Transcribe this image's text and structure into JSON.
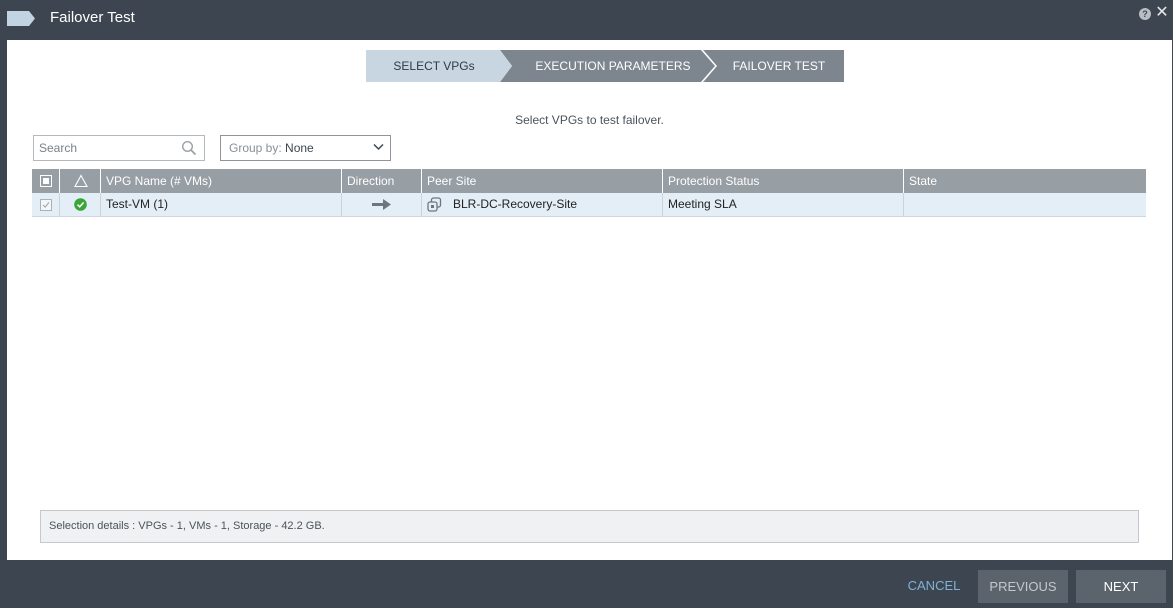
{
  "window": {
    "title": "Failover Test",
    "help_icon": "help-icon",
    "close_icon": "close-icon"
  },
  "wizard": {
    "steps": [
      {
        "label": "SELECT VPGs",
        "active": true
      },
      {
        "label": "EXECUTION PARAMETERS",
        "active": false
      },
      {
        "label": "FAILOVER TEST",
        "active": false
      }
    ],
    "instruction": "Select VPGs to test failover."
  },
  "search": {
    "placeholder": "Search",
    "value": ""
  },
  "group_by": {
    "label": "Group by:",
    "value": "None"
  },
  "grid": {
    "columns": [
      "VPG Name (# VMs)",
      "Direction",
      "Peer Site",
      "Protection Status",
      "State"
    ],
    "rows": [
      {
        "selected": true,
        "status_icon": "check-circle-icon",
        "vpg_name": "Test-VM (1)",
        "direction_icon": "arrow-right-icon",
        "peer_site": "BLR-DC-Recovery-Site",
        "protection_status": "Meeting SLA",
        "state": ""
      }
    ]
  },
  "selection_details": "Selection details :  VPGs  -  1, VMs  -  1, Storage  -  42.2 GB.",
  "footer": {
    "cancel": "CANCEL",
    "previous": "PREVIOUS",
    "next": "NEXT"
  },
  "colors": {
    "title_bar": "#3d4650",
    "active_step": "#c8d6e1",
    "inactive_step": "#7d868f",
    "grid_header": "#979ea4",
    "selected_row": "#e3eef6",
    "status_ok": "#3aa63a",
    "cancel_link": "#7fb2d4"
  }
}
